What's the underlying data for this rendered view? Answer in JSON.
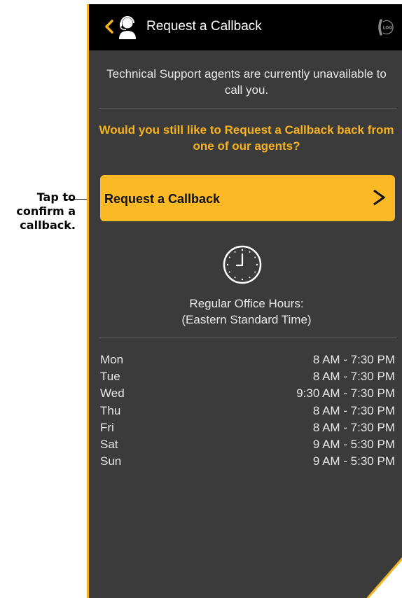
{
  "annotation": {
    "text_lines": [
      "Tap to",
      "confirm a",
      "callback."
    ]
  },
  "header": {
    "title": "Request a Callback",
    "log_label": "LOG"
  },
  "message": "Technical Support agents are currently unavailable to call you.",
  "question": "Would you still like to Request a Callback back from one of our agents?",
  "cta": {
    "label": "Request a Callback"
  },
  "office_hours": {
    "title_line1": "Regular Office Hours:",
    "title_line2": "(Eastern Standard Time)"
  },
  "schedule": [
    {
      "day": "Mon",
      "hours": "8 AM - 7:30 PM"
    },
    {
      "day": "Tue",
      "hours": "8 AM - 7:30 PM"
    },
    {
      "day": "Wed",
      "hours": "9:30 AM - 7:30 PM"
    },
    {
      "day": "Thu",
      "hours": "8 AM - 7:30 PM"
    },
    {
      "day": "Fri",
      "hours": "8 AM - 7:30 PM"
    },
    {
      "day": "Sat",
      "hours": "9 AM - 5:30 PM"
    },
    {
      "day": "Sun",
      "hours": "9 AM - 5:30 PM"
    }
  ],
  "colors": {
    "accent": "#f6b321",
    "button": "#fbb926",
    "panel": "#3b3b3b",
    "header": "#000000",
    "text": "#e8e8e8"
  },
  "icons": {
    "back": "chevron-left-icon",
    "agent": "headset-agent-icon",
    "log": "call-log-icon",
    "chevron": "chevron-right-icon",
    "clock": "clock-icon"
  }
}
